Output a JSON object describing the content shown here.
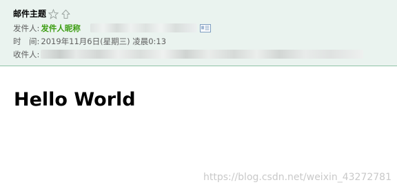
{
  "header": {
    "subject": "邮件主题",
    "sender_label": "发件人:",
    "sender_name": "发件人昵称",
    "time_label": "时　间:",
    "time_value": "2019年11月6日(星期三) 凌晨0:13",
    "recipient_label": "收件人:"
  },
  "body": {
    "heading": "Hello World"
  },
  "watermark": "https://blog.csdn.net/weixin_43272781",
  "icons": {
    "star": "star-outline-icon",
    "flag": "flag-outline-icon",
    "vcard": "contact-card-icon"
  },
  "colors": {
    "header_bg": "#eaf3ef",
    "header_border": "#8fc3a6",
    "sender_name": "#3e9e14",
    "label_text": "#5f5f5f"
  }
}
